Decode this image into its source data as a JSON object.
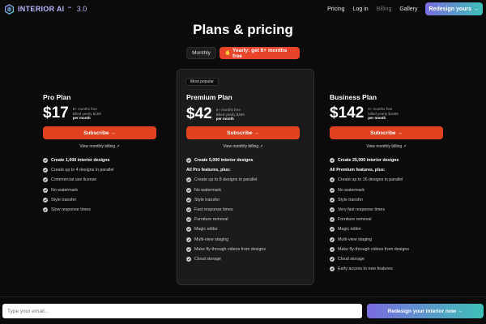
{
  "header": {
    "logo_text": "INTERIOR AI",
    "logo_tm": "™",
    "logo_version": "3.0",
    "nav": [
      "Pricing",
      "Log in",
      "Billing",
      "Gallery"
    ],
    "cta": "Redesign yours →"
  },
  "title": "Plans & pricing",
  "toggle": {
    "monthly": "Monthly",
    "yearly": "Yearly: get 6+ months free",
    "yearly_icon": "fire-icon"
  },
  "plans": [
    {
      "name": "Pro Plan",
      "price": "$17",
      "meta1": "6+ months free",
      "meta2": "billed yearly $199",
      "meta3": "per month",
      "subscribe": "Subscribe →",
      "monthly_link": "View monthly billing ↗",
      "features": [
        {
          "text": "Create 1,000 interior designs",
          "bold": true
        },
        {
          "text": "Create up to 4 designs in parallel"
        },
        {
          "text": "Commercial use license"
        },
        {
          "text": "No watermark"
        },
        {
          "text": "Style transfer"
        },
        {
          "text": "Slow response times"
        }
      ]
    },
    {
      "badge": "Most popular",
      "name": "Premium Plan",
      "price": "$42",
      "meta1": "6+ months free",
      "meta2": "billed yearly $499",
      "meta3": "per month",
      "subscribe": "Subscribe →",
      "monthly_link": "View monthly billing ↗",
      "features": [
        {
          "text": "Create 5,000 interior designs",
          "bold": true
        },
        {
          "text": "All Pro features, plus:",
          "header": true
        },
        {
          "text": "Create up to 8 designs in parallel"
        },
        {
          "text": "No watermark"
        },
        {
          "text": "Style transfer"
        },
        {
          "text": "Fast response times"
        },
        {
          "text": "Furniture removal"
        },
        {
          "text": "Magic editor"
        },
        {
          "text": "Multi-view staging"
        },
        {
          "text": "Make fly-through videos from designs"
        },
        {
          "text": "Cloud storage"
        }
      ]
    },
    {
      "name": "Business Plan",
      "price": "$142",
      "meta1": "6+ months free",
      "meta2": "billed yearly $1699",
      "meta3": "per month",
      "subscribe": "Subscribe →",
      "monthly_link": "View monthly billing ↗",
      "features": [
        {
          "text": "Create 25,000 interior designs",
          "bold": true
        },
        {
          "text": "All Premium features, plus:",
          "header": true
        },
        {
          "text": "Create up to 16 designs in parallel"
        },
        {
          "text": "No watermark"
        },
        {
          "text": "Style transfer"
        },
        {
          "text": "Very fast response times"
        },
        {
          "text": "Furniture removal"
        },
        {
          "text": "Magic editor"
        },
        {
          "text": "Multi-view staging"
        },
        {
          "text": "Make fly-through videos from designs"
        },
        {
          "text": "Cloud storage"
        },
        {
          "text": "Early access to new features"
        }
      ]
    }
  ],
  "bottom": {
    "email_placeholder": "Type your email...",
    "cta": "Redesign your interior now →"
  },
  "colors": {
    "accent_orange": "#e0411f",
    "gradient_start": "#7a6ce0",
    "gradient_end": "#3ec0b6",
    "background": "#0b0b0b"
  }
}
